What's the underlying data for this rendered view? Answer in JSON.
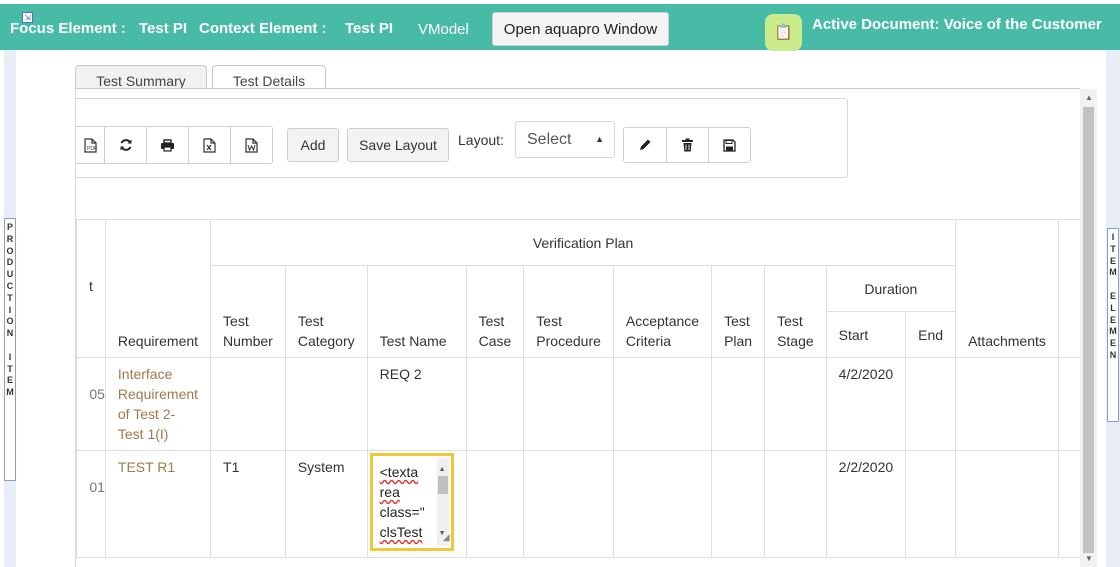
{
  "header": {
    "focus_label": "Focus Element :",
    "focus_value": "Test PI",
    "context_label": "Context Element :",
    "context_value": "Test PI",
    "vmodel": "VModel",
    "open_button": "Open aquapro Window",
    "active_document": "Active Document: Voice of the Customer"
  },
  "side_labels": {
    "left": [
      "P",
      "R",
      "O",
      "D",
      "U",
      "C",
      "T",
      "I",
      "O",
      "N",
      "",
      "I",
      "T",
      "E",
      "M"
    ],
    "right": [
      "I",
      "T",
      "E",
      "M",
      "",
      "E",
      "L",
      "E",
      "M",
      "E",
      "N"
    ]
  },
  "tabs": [
    {
      "label": "Test Summary"
    },
    {
      "label": "Test Details"
    }
  ],
  "toolbar": {
    "add_label": "Add",
    "save_layout_label": "Save Layout",
    "layout_label": "Layout:",
    "layout_select_value": "Select"
  },
  "table": {
    "group_header": "Verification Plan",
    "duration_header": "Duration",
    "cut_header": "t",
    "columns": {
      "requirement": "Requirement",
      "test_number": "Test Number",
      "test_category": "Test Category",
      "test_name": "Test Name",
      "test_case": "Test Case",
      "test_procedure": "Test Procedure",
      "acceptance_criteria": "Acceptance Criteria",
      "test_plan": "Test Plan",
      "test_stage": "Test Stage",
      "start": "Start",
      "end": "End",
      "attachments": "Attachments"
    },
    "rows": [
      {
        "id_fragment": "05",
        "requirement": "Interface Requirement of Test 2-Test 1(I)",
        "test_number": "",
        "test_category": "",
        "test_name": "REQ 2",
        "start": "4/2/2020",
        "end": ""
      },
      {
        "id_fragment": "01",
        "requirement": "TEST R1",
        "test_number": "T1",
        "test_category": "System",
        "test_name_editor": {
          "line1": "<texta",
          "line2": "rea",
          "line3": "class=\"",
          "line4": "clsTest"
        },
        "start": "2/2/2020",
        "end": ""
      }
    ]
  }
}
